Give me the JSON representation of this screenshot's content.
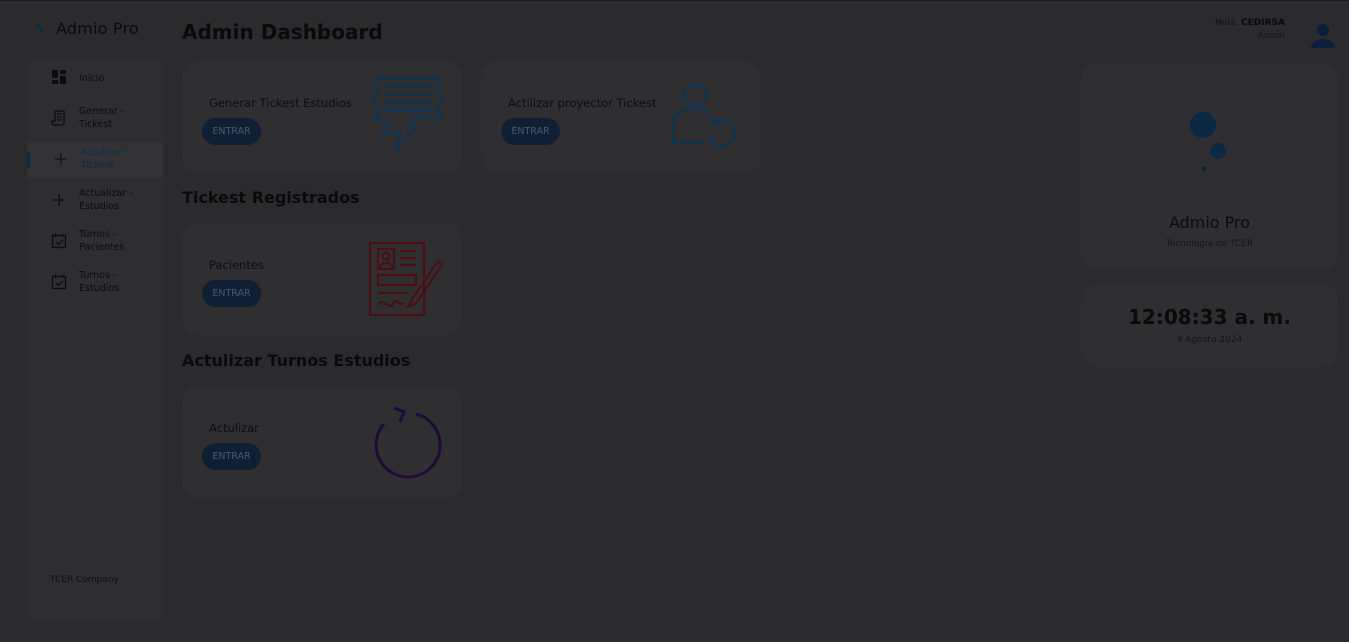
{
  "brand": {
    "name": "Admio Pro"
  },
  "sidebar": {
    "items": [
      {
        "line1": "Inicio",
        "line2": "",
        "icon": "dashboard-icon"
      },
      {
        "line1": "Generar -",
        "line2": "Tickest",
        "icon": "document-icon"
      },
      {
        "line1": "Actulizar -",
        "line2": "Tickest",
        "icon": "plus-icon",
        "active": true
      },
      {
        "line1": "Actualizar -",
        "line2": "Estudios",
        "icon": "plus-icon"
      },
      {
        "line1": "Turnos -",
        "line2": "Pacientes",
        "icon": "calendar-check-icon"
      },
      {
        "line1": "Turnos -",
        "line2": "Estudios",
        "icon": "calendar-check-icon"
      }
    ],
    "footer": "TCER Company"
  },
  "header": {
    "title": "Admin Dashboard",
    "greeting": "Hola,",
    "user": "CEDIRSA",
    "role": "Admin"
  },
  "sections": {
    "registered": "Tickest Registrados",
    "turnos": "Actulizar Turnos Estudios"
  },
  "cards": {
    "generar": {
      "label": "Generar Tickest Estudios",
      "button": "ENTRAR"
    },
    "proyector": {
      "label": "Actilizar proyector Tickest",
      "button": "ENTRAR"
    },
    "pacientes": {
      "label": "Pacientes",
      "button": "ENTRAR"
    },
    "actulizar": {
      "label": "Actulizar",
      "button": "ENTRAR"
    }
  },
  "info": {
    "title": "Admio Pro",
    "subtitle": "Tecnologia de TCER"
  },
  "clock": {
    "time": "12:08:33 a. m.",
    "date": "9 Agosto 2024"
  },
  "colors": {
    "background": "#2b2b2d",
    "card": "#2f2f31",
    "button": "#0f2035",
    "accent_blue": "#0a3553",
    "accent_red": "#4a0f12",
    "accent_purple": "#1e0b3a"
  }
}
